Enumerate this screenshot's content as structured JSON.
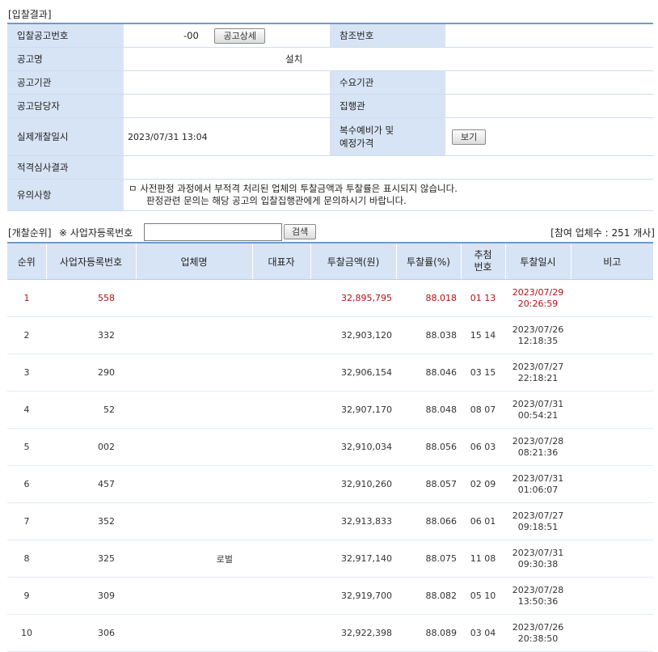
{
  "section_title": "[입찰결과]",
  "info": {
    "notice_no_label": "입찰공고번호",
    "notice_no_value": "-00",
    "notice_detail_button": "공고상세",
    "ref_no_label": "참조번호",
    "ref_no_value": "",
    "notice_name_label": "공고명",
    "notice_name_value": "설치",
    "agency_label": "공고기관",
    "agency_value": "",
    "demand_agency_label": "수요기관",
    "demand_agency_value": "",
    "manager_label": "공고담당자",
    "manager_value": "",
    "executor_label": "집행관",
    "executor_value": "",
    "open_date_label": "실제개찰일시",
    "open_date_value": "2023/07/31 13:04",
    "multi_price_label_1": "복수예비가 및",
    "multi_price_label_2": "예정가격",
    "view_button": "보기",
    "review_label": "적격심사결과",
    "review_value": "",
    "remarks_label": "유의사항",
    "remarks_line1": "ㅁ 사전판정 과정에서 부적격 처리된 업체의 투찰금액과 투찰률은 표시되지 않습니다.",
    "remarks_line2": "판정관련 문의는 해당 공고의 입찰집행관에게 문의하시기 바랍니다."
  },
  "search": {
    "rank_label": "[개찰순위]",
    "note_label": "※ 사업자등록번호",
    "input_value": "",
    "search_button": "검색",
    "count_text": "[참여 업체수 : 251 개사]"
  },
  "table": {
    "headers": [
      "순위",
      "사업자등록번호",
      "업체명",
      "대표자",
      "투찰금액(원)",
      "투찰률(%)",
      "추첨\n번호",
      "투찰일시",
      "비고"
    ],
    "header_lottery_1": "추첨",
    "header_lottery_2": "번호",
    "rows": [
      {
        "rank": "1",
        "bizno": "558",
        "company": "",
        "rep": "",
        "amount": "32,895,795",
        "rate": "88.018",
        "lottery": "01 13",
        "date": "2023/07/29",
        "time": "20:26:59",
        "note": ""
      },
      {
        "rank": "2",
        "bizno": "332",
        "company": "",
        "rep": "",
        "amount": "32,903,120",
        "rate": "88.038",
        "lottery": "15 14",
        "date": "2023/07/26",
        "time": "12:18:35",
        "note": ""
      },
      {
        "rank": "3",
        "bizno": "290",
        "company": "",
        "rep": "",
        "amount": "32,906,154",
        "rate": "88.046",
        "lottery": "03 15",
        "date": "2023/07/27",
        "time": "22:18:21",
        "note": ""
      },
      {
        "rank": "4",
        "bizno": "52",
        "company": "",
        "rep": "",
        "amount": "32,907,170",
        "rate": "88.048",
        "lottery": "08 07",
        "date": "2023/07/31",
        "time": "00:54:21",
        "note": ""
      },
      {
        "rank": "5",
        "bizno": "002",
        "company": "",
        "rep": "",
        "amount": "32,910,034",
        "rate": "88.056",
        "lottery": "06 03",
        "date": "2023/07/28",
        "time": "08:21:36",
        "note": ""
      },
      {
        "rank": "6",
        "bizno": "457",
        "company": "",
        "rep": "",
        "amount": "32,910,260",
        "rate": "88.057",
        "lottery": "02 09",
        "date": "2023/07/31",
        "time": "01:06:07",
        "note": ""
      },
      {
        "rank": "7",
        "bizno": "352",
        "company": "",
        "rep": "",
        "amount": "32,913,833",
        "rate": "88.066",
        "lottery": "06 01",
        "date": "2023/07/27",
        "time": "09:18:51",
        "note": ""
      },
      {
        "rank": "8",
        "bizno": "325",
        "company": "로벌",
        "rep": "",
        "amount": "32,917,140",
        "rate": "88.075",
        "lottery": "11 08",
        "date": "2023/07/31",
        "time": "09:30:38",
        "note": ""
      },
      {
        "rank": "9",
        "bizno": "309",
        "company": "",
        "rep": "",
        "amount": "32,919,700",
        "rate": "88.082",
        "lottery": "05 10",
        "date": "2023/07/28",
        "time": "13:50:36",
        "note": ""
      },
      {
        "rank": "10",
        "bizno": "306",
        "company": "",
        "rep": "",
        "amount": "32,922,398",
        "rate": "88.089",
        "lottery": "03 04",
        "date": "2023/07/26",
        "time": "20:38:50",
        "note": ""
      }
    ]
  },
  "colors": {
    "label_bg": "#d7e4f5",
    "border_blue": "#6b9bd0",
    "highlight_red": "#b0121a"
  }
}
